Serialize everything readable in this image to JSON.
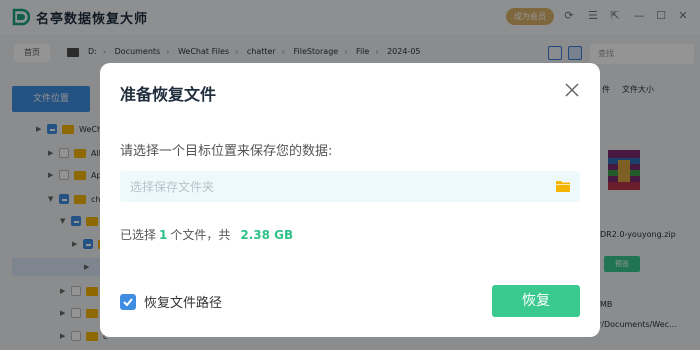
{
  "app": {
    "title": "名亭数据恢复大师",
    "vip_label": "成为会员"
  },
  "pathbar": {
    "home_label": "首页",
    "drive": "D:",
    "crumbs": [
      "Documents",
      "WeChat Files",
      "chatter",
      "FileStorage",
      "File",
      "2024-05"
    ],
    "search_placeholder": "查找"
  },
  "sidebar": {
    "location_tab": "文件位置",
    "tree": [
      {
        "label": "WeChat"
      },
      {
        "label": "All U"
      },
      {
        "label": "App"
      },
      {
        "label": "chat"
      },
      {
        "label": "F"
      },
      {
        "label": ""
      },
      {
        "label": ""
      },
      {
        "label": "c"
      },
      {
        "label": "c"
      },
      {
        "label": "c"
      }
    ]
  },
  "right_panel": {
    "sort_type": "件",
    "sort_size": "文件大小",
    "file_name": "DR2.0-youyong.zip",
    "preview_label": "预览",
    "file_size": "MB",
    "file_path": "r/Documents/Wec..."
  },
  "modal": {
    "title": "准备恢复文件",
    "prompt": "请选择一个目标位置来保存您的数据:",
    "folder_placeholder": "选择保存文件夹",
    "folder_value": "",
    "summary_prefix": "已选择",
    "summary_count": "1",
    "summary_mid": "个文件，共",
    "summary_size": "2.38 GB",
    "keep_path_label": "恢复文件路径",
    "keep_path_checked": true,
    "recover_label": "恢复"
  },
  "colors": {
    "accent_blue": "#3e8de0",
    "accent_green": "#3ac98f",
    "highlight_green": "#2ec28a",
    "vip_gold": "#d9b26a"
  }
}
